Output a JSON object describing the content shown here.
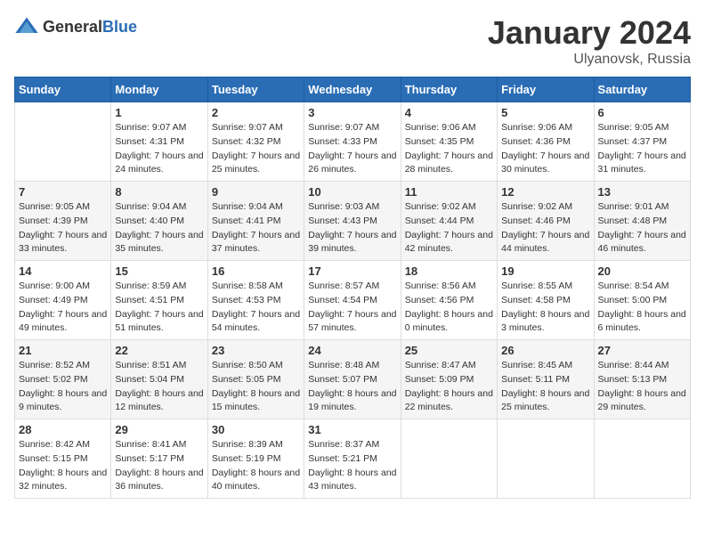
{
  "header": {
    "logo_general": "General",
    "logo_blue": "Blue",
    "month": "January 2024",
    "location": "Ulyanovsk, Russia"
  },
  "weekdays": [
    "Sunday",
    "Monday",
    "Tuesday",
    "Wednesday",
    "Thursday",
    "Friday",
    "Saturday"
  ],
  "weeks": [
    [
      {
        "day": "",
        "sunrise": "",
        "sunset": "",
        "daylight": ""
      },
      {
        "day": "1",
        "sunrise": "Sunrise: 9:07 AM",
        "sunset": "Sunset: 4:31 PM",
        "daylight": "Daylight: 7 hours and 24 minutes."
      },
      {
        "day": "2",
        "sunrise": "Sunrise: 9:07 AM",
        "sunset": "Sunset: 4:32 PM",
        "daylight": "Daylight: 7 hours and 25 minutes."
      },
      {
        "day": "3",
        "sunrise": "Sunrise: 9:07 AM",
        "sunset": "Sunset: 4:33 PM",
        "daylight": "Daylight: 7 hours and 26 minutes."
      },
      {
        "day": "4",
        "sunrise": "Sunrise: 9:06 AM",
        "sunset": "Sunset: 4:35 PM",
        "daylight": "Daylight: 7 hours and 28 minutes."
      },
      {
        "day": "5",
        "sunrise": "Sunrise: 9:06 AM",
        "sunset": "Sunset: 4:36 PM",
        "daylight": "Daylight: 7 hours and 30 minutes."
      },
      {
        "day": "6",
        "sunrise": "Sunrise: 9:05 AM",
        "sunset": "Sunset: 4:37 PM",
        "daylight": "Daylight: 7 hours and 31 minutes."
      }
    ],
    [
      {
        "day": "7",
        "sunrise": "Sunrise: 9:05 AM",
        "sunset": "Sunset: 4:39 PM",
        "daylight": "Daylight: 7 hours and 33 minutes."
      },
      {
        "day": "8",
        "sunrise": "Sunrise: 9:04 AM",
        "sunset": "Sunset: 4:40 PM",
        "daylight": "Daylight: 7 hours and 35 minutes."
      },
      {
        "day": "9",
        "sunrise": "Sunrise: 9:04 AM",
        "sunset": "Sunset: 4:41 PM",
        "daylight": "Daylight: 7 hours and 37 minutes."
      },
      {
        "day": "10",
        "sunrise": "Sunrise: 9:03 AM",
        "sunset": "Sunset: 4:43 PM",
        "daylight": "Daylight: 7 hours and 39 minutes."
      },
      {
        "day": "11",
        "sunrise": "Sunrise: 9:02 AM",
        "sunset": "Sunset: 4:44 PM",
        "daylight": "Daylight: 7 hours and 42 minutes."
      },
      {
        "day": "12",
        "sunrise": "Sunrise: 9:02 AM",
        "sunset": "Sunset: 4:46 PM",
        "daylight": "Daylight: 7 hours and 44 minutes."
      },
      {
        "day": "13",
        "sunrise": "Sunrise: 9:01 AM",
        "sunset": "Sunset: 4:48 PM",
        "daylight": "Daylight: 7 hours and 46 minutes."
      }
    ],
    [
      {
        "day": "14",
        "sunrise": "Sunrise: 9:00 AM",
        "sunset": "Sunset: 4:49 PM",
        "daylight": "Daylight: 7 hours and 49 minutes."
      },
      {
        "day": "15",
        "sunrise": "Sunrise: 8:59 AM",
        "sunset": "Sunset: 4:51 PM",
        "daylight": "Daylight: 7 hours and 51 minutes."
      },
      {
        "day": "16",
        "sunrise": "Sunrise: 8:58 AM",
        "sunset": "Sunset: 4:53 PM",
        "daylight": "Daylight: 7 hours and 54 minutes."
      },
      {
        "day": "17",
        "sunrise": "Sunrise: 8:57 AM",
        "sunset": "Sunset: 4:54 PM",
        "daylight": "Daylight: 7 hours and 57 minutes."
      },
      {
        "day": "18",
        "sunrise": "Sunrise: 8:56 AM",
        "sunset": "Sunset: 4:56 PM",
        "daylight": "Daylight: 8 hours and 0 minutes."
      },
      {
        "day": "19",
        "sunrise": "Sunrise: 8:55 AM",
        "sunset": "Sunset: 4:58 PM",
        "daylight": "Daylight: 8 hours and 3 minutes."
      },
      {
        "day": "20",
        "sunrise": "Sunrise: 8:54 AM",
        "sunset": "Sunset: 5:00 PM",
        "daylight": "Daylight: 8 hours and 6 minutes."
      }
    ],
    [
      {
        "day": "21",
        "sunrise": "Sunrise: 8:52 AM",
        "sunset": "Sunset: 5:02 PM",
        "daylight": "Daylight: 8 hours and 9 minutes."
      },
      {
        "day": "22",
        "sunrise": "Sunrise: 8:51 AM",
        "sunset": "Sunset: 5:04 PM",
        "daylight": "Daylight: 8 hours and 12 minutes."
      },
      {
        "day": "23",
        "sunrise": "Sunrise: 8:50 AM",
        "sunset": "Sunset: 5:05 PM",
        "daylight": "Daylight: 8 hours and 15 minutes."
      },
      {
        "day": "24",
        "sunrise": "Sunrise: 8:48 AM",
        "sunset": "Sunset: 5:07 PM",
        "daylight": "Daylight: 8 hours and 19 minutes."
      },
      {
        "day": "25",
        "sunrise": "Sunrise: 8:47 AM",
        "sunset": "Sunset: 5:09 PM",
        "daylight": "Daylight: 8 hours and 22 minutes."
      },
      {
        "day": "26",
        "sunrise": "Sunrise: 8:45 AM",
        "sunset": "Sunset: 5:11 PM",
        "daylight": "Daylight: 8 hours and 25 minutes."
      },
      {
        "day": "27",
        "sunrise": "Sunrise: 8:44 AM",
        "sunset": "Sunset: 5:13 PM",
        "daylight": "Daylight: 8 hours and 29 minutes."
      }
    ],
    [
      {
        "day": "28",
        "sunrise": "Sunrise: 8:42 AM",
        "sunset": "Sunset: 5:15 PM",
        "daylight": "Daylight: 8 hours and 32 minutes."
      },
      {
        "day": "29",
        "sunrise": "Sunrise: 8:41 AM",
        "sunset": "Sunset: 5:17 PM",
        "daylight": "Daylight: 8 hours and 36 minutes."
      },
      {
        "day": "30",
        "sunrise": "Sunrise: 8:39 AM",
        "sunset": "Sunset: 5:19 PM",
        "daylight": "Daylight: 8 hours and 40 minutes."
      },
      {
        "day": "31",
        "sunrise": "Sunrise: 8:37 AM",
        "sunset": "Sunset: 5:21 PM",
        "daylight": "Daylight: 8 hours and 43 minutes."
      },
      {
        "day": "",
        "sunrise": "",
        "sunset": "",
        "daylight": ""
      },
      {
        "day": "",
        "sunrise": "",
        "sunset": "",
        "daylight": ""
      },
      {
        "day": "",
        "sunrise": "",
        "sunset": "",
        "daylight": ""
      }
    ]
  ]
}
